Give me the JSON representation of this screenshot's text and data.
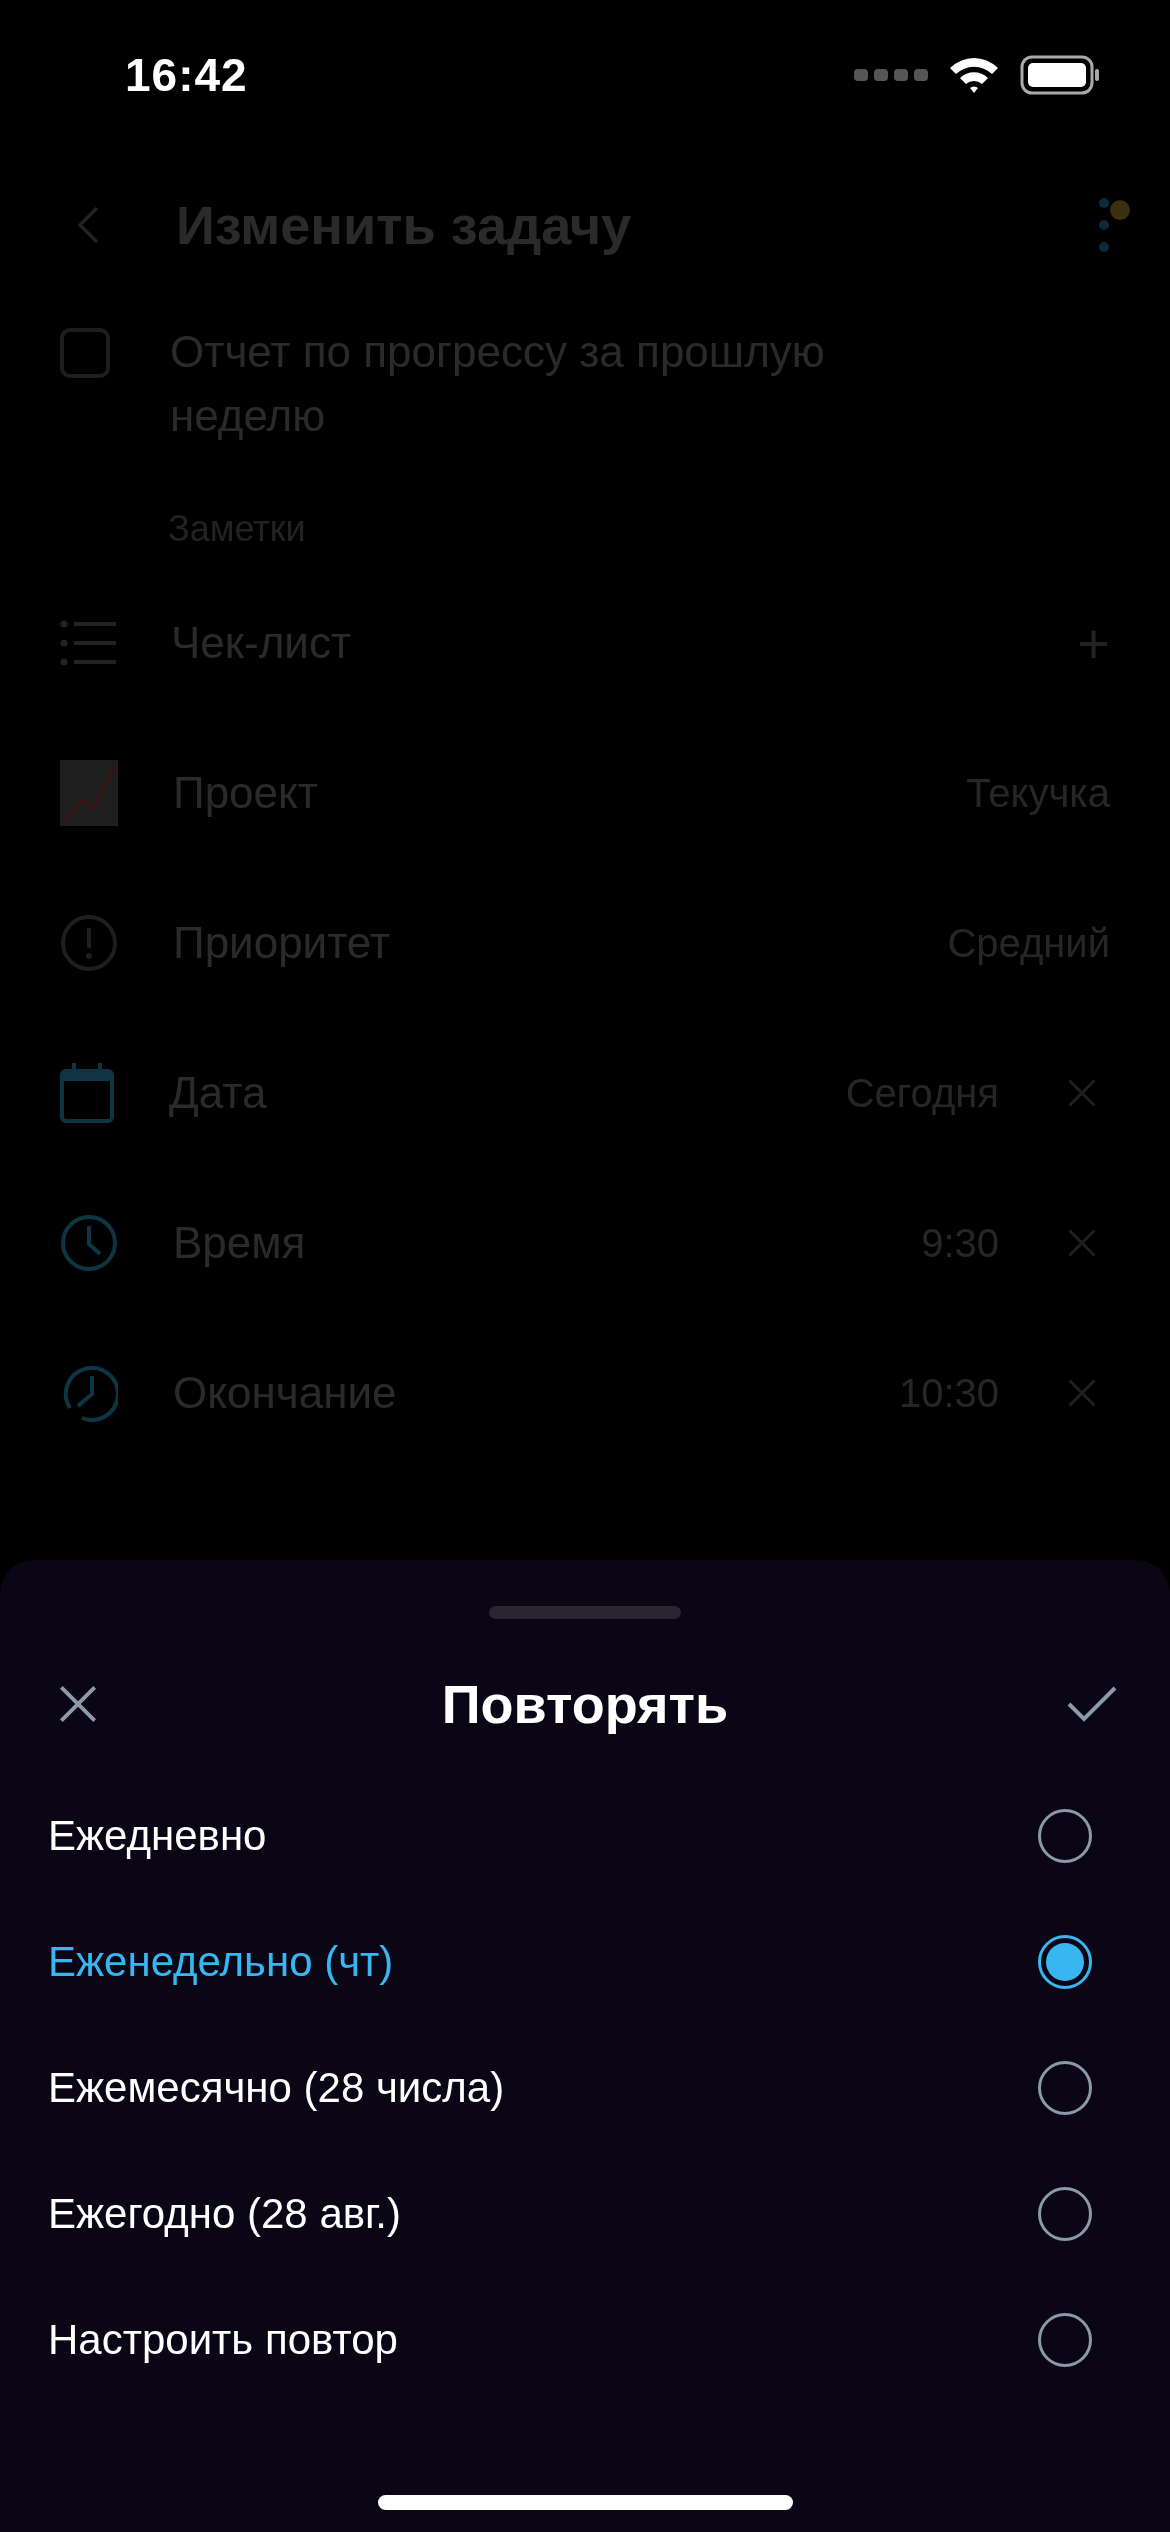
{
  "status_bar": {
    "time": "16:42"
  },
  "header": {
    "title": "Изменить задачу"
  },
  "task": {
    "title": "Отчет по прогрессу за прошлую неделю",
    "checked": false
  },
  "notes": {
    "placeholder": "Заметки"
  },
  "rows": [
    {
      "kind": "action",
      "label": "Чек-лист",
      "action": "+"
    },
    {
      "kind": "value",
      "label": "Проект",
      "value": "Текучка"
    },
    {
      "kind": "value",
      "label": "Приоритет",
      "value": "Средний"
    },
    {
      "kind": "clearable",
      "label": "Дата",
      "value": "Сегодня"
    },
    {
      "kind": "clearable",
      "label": "Время",
      "value": "9:30"
    },
    {
      "kind": "clearable",
      "label": "Окончание",
      "value": "10:30"
    }
  ],
  "sheet": {
    "title": "Повторять",
    "options": [
      {
        "label": "Ежедневно",
        "selected": false
      },
      {
        "label": "Еженедельно (чт)",
        "selected": true
      },
      {
        "label": "Ежемесячно (28 числа)",
        "selected": false
      },
      {
        "label": "Ежегодно (28 авг.)",
        "selected": false
      },
      {
        "label": "Настроить повтор",
        "selected": false
      }
    ]
  }
}
